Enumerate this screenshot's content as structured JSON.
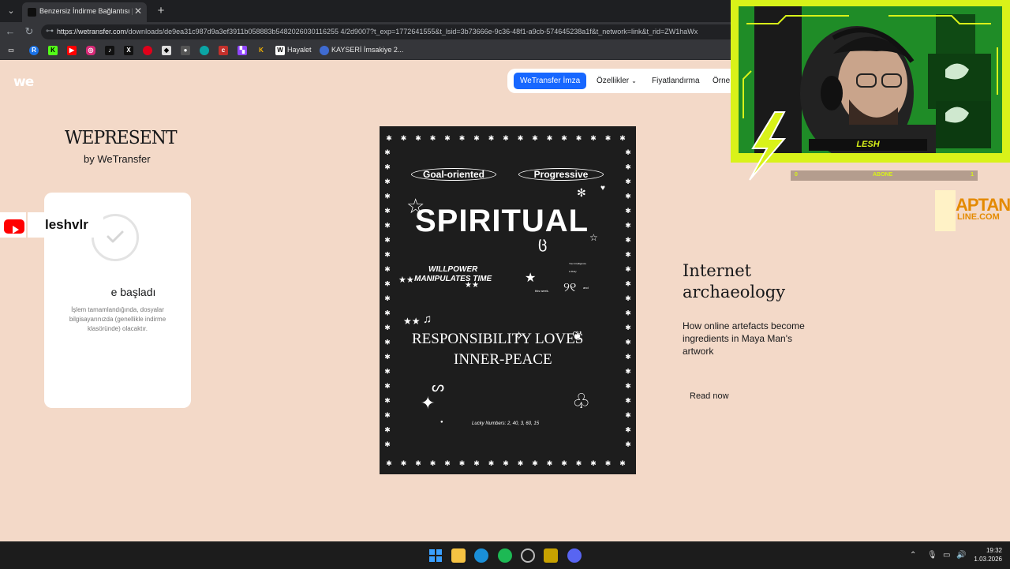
{
  "browser": {
    "tab_title": "Benzersiz İndirme Bağlantısı | WeTr",
    "tab_close": "✕",
    "new_tab": "+",
    "url_domain": "https://wetransfer.com",
    "url_path": "/downloads/de9ea31c987d9a3ef3911b058883b5482026030116255 4/2d9007?t_exp=1772641555&t_lsid=3b73666e-9c36-48f1-a9cb-574645238a1f&t_network=link&t_rid=ZW1haWx",
    "bookmarks": [
      {
        "label": "Hayalet"
      },
      {
        "label": "KAYSERİ İmsakiye 2..."
      }
    ]
  },
  "site": {
    "logo": "we",
    "nav": {
      "primary": "WeTransfer İmza",
      "features": "Özellikler",
      "pricing": "Fiyatlandırma",
      "examples": "Örne"
    },
    "wepresent": {
      "title": "WEPRESENT",
      "subtitle": "by WeTransfer"
    },
    "panel": {
      "title": "e başladı",
      "description": "İşlem tamamlandığında, dosyalar bilgisayarınızda (genellikle indirme klasöründe) olacaktır."
    },
    "artwork": {
      "pill_left": "Goal-oriented",
      "pill_right": "Progressive",
      "headline": "SPIRITUAL",
      "line1": "WILLPOWER",
      "line2": "MANIPULATES TIME",
      "line3": "RESPONSIBILITY LOVES",
      "line4": "INNER-PEACE",
      "lucky": "Lucky Numbers: 2, 40, 3, 60, 15",
      "small1": "Your intelligence",
      "small2": "is likely",
      "small3": "this week.",
      "small4": "and"
    },
    "article": {
      "title": "Internet archaeology",
      "description": "How online artefacts become ingredients in Maya Man's artwork",
      "cta": "Read now"
    }
  },
  "stream": {
    "youtube_name": "leshvlr",
    "cam_name": "LESH",
    "sub_left": "0",
    "sub_label": "ABONE",
    "sub_right": "1",
    "logo_text": "APTAN",
    "logo_text2": "LINE.COM"
  },
  "taskbar": {
    "time": "19:32",
    "date": "1.03.2026"
  },
  "colors": {
    "page_bg": "#f3d9c8",
    "brand_blue": "#1767ff",
    "stream_green": "#d9f219"
  }
}
